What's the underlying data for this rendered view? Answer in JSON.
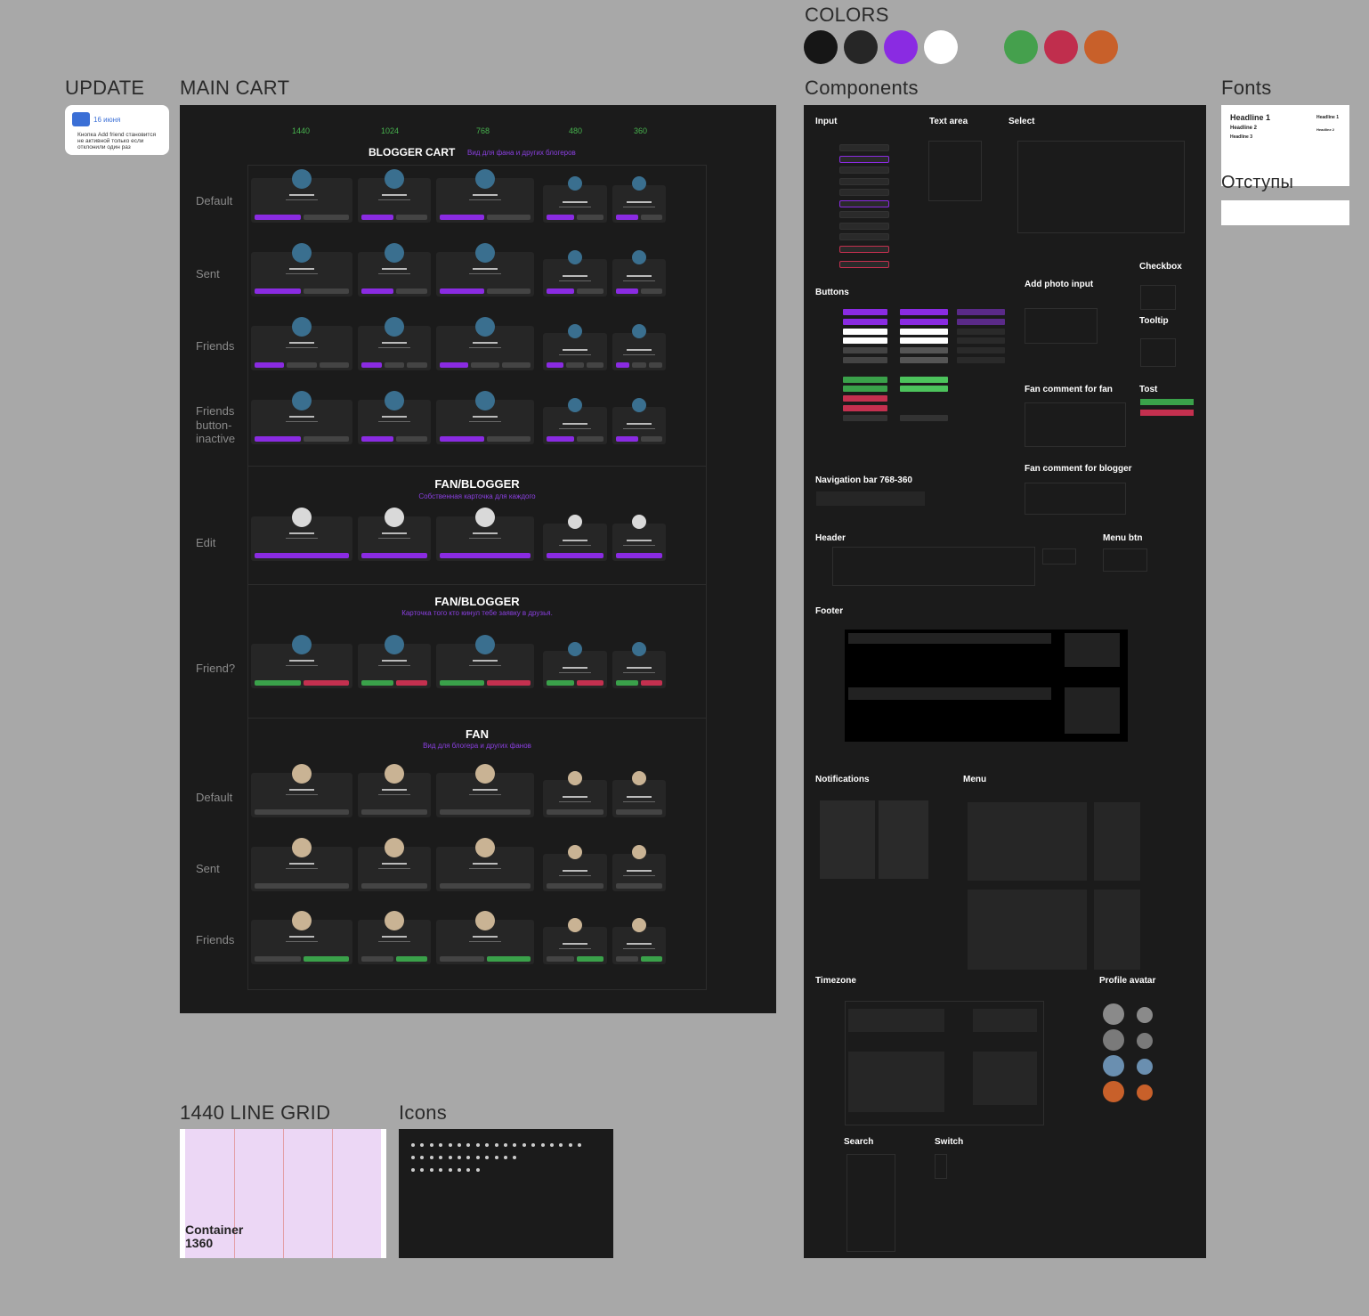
{
  "sections": {
    "colors": "COLORS",
    "update": "UPDATE",
    "main_cart": "MAIN CART",
    "components": "Components",
    "fonts": "Fonts",
    "otstupy": "Отступы",
    "line_grid": "1440 LINE GRID",
    "icons": "Icons"
  },
  "colors": [
    "#161616",
    "#262626",
    "#8a2be2",
    "#ffffff",
    "#a8a8a8",
    "#45a04d",
    "#c02e4d",
    "#c8602a"
  ],
  "update_note": {
    "date": "16 июня",
    "text": "Кнопка Add friend становится не активной только если отклонили один раз"
  },
  "breakpoints": [
    "1440",
    "1024",
    "768",
    "480",
    "360"
  ],
  "blogger_cart": {
    "title": "BLOGGER CART",
    "subtitle": "Вид для фана и других блогеров"
  },
  "fan_blogger_1": {
    "title": "FAN/BLOGGER",
    "subtitle": "Собственная карточка для каждого"
  },
  "fan_blogger_2": {
    "title": "FAN/BLOGGER",
    "subtitle": "Карточка того кто кинул тебе заявку в друзья."
  },
  "fan": {
    "title": "FAN",
    "subtitle": "Вид для блогера и других фанов"
  },
  "row_labels": {
    "default": "Default",
    "sent": "Sent",
    "friends": "Friends",
    "inactive": "Friends button-inactive",
    "edit": "Edit",
    "friend_q": "Friend?",
    "fan_default": "Default",
    "fan_sent": "Sent",
    "fan_friends": "Friends"
  },
  "comp": {
    "input": "Input",
    "textarea": "Text area",
    "select": "Select",
    "checkbox": "Checkbox",
    "buttons": "Buttons",
    "add_photo": "Add photo input",
    "tooltip": "Tooltip",
    "fan_comment_fan": "Fan comment for fan",
    "tost": "Tost",
    "fan_comment_blogger": "Fan comment for blogger",
    "navbar": "Navigation bar 768-360",
    "header": "Header",
    "menu_btn": "Menu btn",
    "footer": "Footer",
    "notifications": "Notifications",
    "menu": "Menu",
    "timezone": "Timezone",
    "profile_avatar": "Profile avatar",
    "search": "Search",
    "switch": "Switch"
  },
  "fonts_panel": {
    "h1": "Headline 1",
    "h2": "Headline 2",
    "h3": "Headline 3",
    "h1r": "Headline 1",
    "h2r": "Headline 2"
  },
  "grid": {
    "container": "Container",
    "width": "1360"
  }
}
